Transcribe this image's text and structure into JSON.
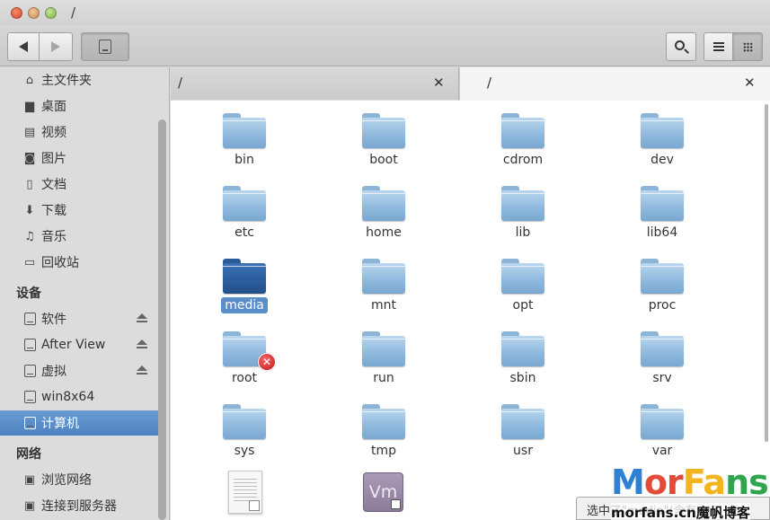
{
  "window": {
    "title": "/"
  },
  "sidebar": {
    "places": [
      {
        "label": "主文件夹",
        "icon": "home-icon"
      },
      {
        "label": "桌面",
        "icon": "folder-icon"
      },
      {
        "label": "视频",
        "icon": "film-icon"
      },
      {
        "label": "图片",
        "icon": "camera-icon"
      },
      {
        "label": "文档",
        "icon": "document-icon"
      },
      {
        "label": "下载",
        "icon": "download-icon"
      },
      {
        "label": "音乐",
        "icon": "music-icon"
      },
      {
        "label": "回收站",
        "icon": "trash-icon"
      }
    ],
    "devices_header": "设备",
    "devices": [
      {
        "label": "软件",
        "icon": "drive-icon",
        "eject": true
      },
      {
        "label": "After View",
        "icon": "drive-icon",
        "eject": true
      },
      {
        "label": "虚拟",
        "icon": "drive-icon",
        "eject": true
      },
      {
        "label": "win8x64",
        "icon": "drive-icon",
        "eject": false
      },
      {
        "label": "计算机",
        "icon": "drive-icon",
        "eject": false,
        "selected": true
      }
    ],
    "network_header": "网络",
    "network": [
      {
        "label": "浏览网络",
        "icon": "network-icon"
      },
      {
        "label": "连接到服务器",
        "icon": "server-icon"
      }
    ]
  },
  "tabs": [
    {
      "label": "/",
      "active": false
    },
    {
      "label": "/",
      "active": true
    }
  ],
  "files": [
    {
      "name": "bin"
    },
    {
      "name": "boot"
    },
    {
      "name": "cdrom"
    },
    {
      "name": "dev"
    },
    {
      "name": "etc"
    },
    {
      "name": "home"
    },
    {
      "name": "lib"
    },
    {
      "name": "lib64"
    },
    {
      "name": "media",
      "selected": true
    },
    {
      "name": "mnt"
    },
    {
      "name": "opt"
    },
    {
      "name": "proc"
    },
    {
      "name": "root",
      "no_access": true
    },
    {
      "name": "run"
    },
    {
      "name": "sbin"
    },
    {
      "name": "srv"
    },
    {
      "name": "sys"
    },
    {
      "name": "tmp"
    },
    {
      "name": "usr"
    },
    {
      "name": "var"
    }
  ],
  "extra_files": [
    {
      "type": "document-link",
      "icon": "text-file-link-icon"
    },
    {
      "type": "vm-link",
      "icon": "vmware-link-icon",
      "glyph": "Vm"
    }
  ],
  "statusbar": {
    "text": "选中了\"media\"(含有"
  },
  "watermark": {
    "big": [
      "M",
      "or",
      "Fa",
      "ns"
    ],
    "small": "morfans.cn魔帆博客"
  }
}
